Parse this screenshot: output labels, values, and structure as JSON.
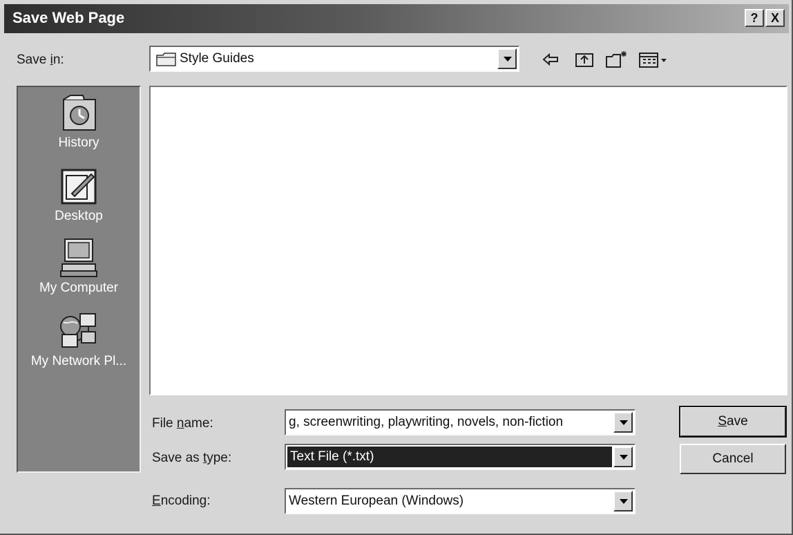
{
  "window": {
    "title": "Save Web Page",
    "help_label": "?",
    "close_label": "X"
  },
  "save_in": {
    "label_pre": "Save ",
    "label_accel": "i",
    "label_post": "n:",
    "value": "Style Guides"
  },
  "toolbar": {
    "icons": [
      "back-icon",
      "up-folder-icon",
      "new-folder-icon",
      "view-menu-icon"
    ]
  },
  "places": [
    {
      "label": "History",
      "icon": "history-icon"
    },
    {
      "label": "Desktop",
      "icon": "desktop-icon"
    },
    {
      "label": "My Computer",
      "icon": "my-computer-icon"
    },
    {
      "label": "My Network Pl...",
      "icon": "network-places-icon"
    }
  ],
  "fields": {
    "file_name": {
      "label_pre": "File ",
      "label_accel": "n",
      "label_post": "ame:",
      "value": "g, screenwriting, playwriting, novels, non-fiction"
    },
    "save_as_type": {
      "label_pre": "Save as ",
      "label_accel": "t",
      "label_post": "ype:",
      "value": "Text File (*.txt)"
    },
    "encoding": {
      "label_pre": "",
      "label_accel": "E",
      "label_post": "ncoding:",
      "value": "Western European (Windows)"
    }
  },
  "buttons": {
    "save_accel": "S",
    "save_rest": "ave",
    "cancel": "Cancel"
  },
  "colors": {
    "title_dark": "#2e2e2e",
    "places_bg": "#838383",
    "selection": "#222222"
  }
}
